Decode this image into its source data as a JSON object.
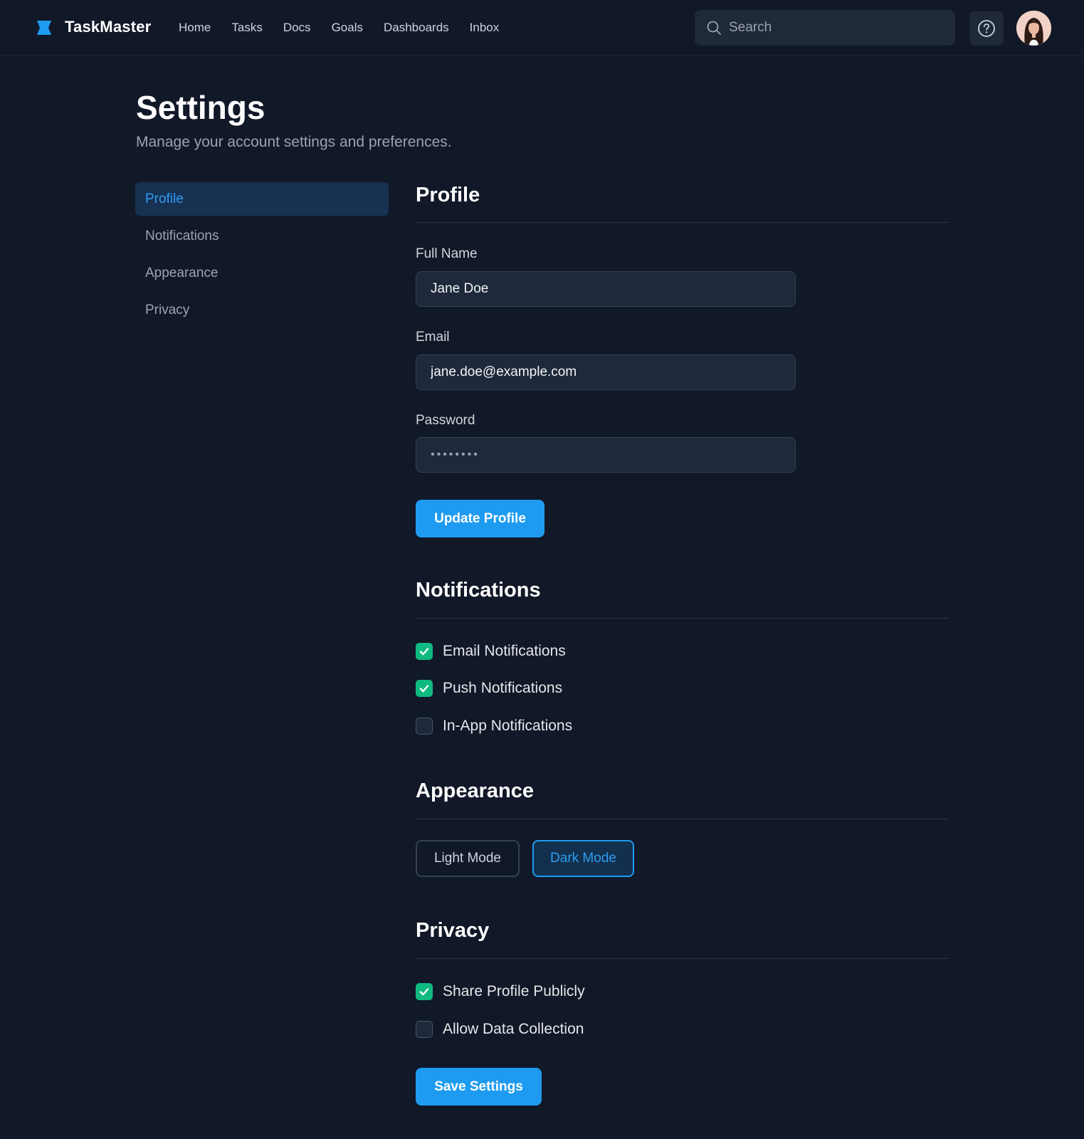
{
  "app": {
    "brand": "TaskMaster",
    "nav": [
      "Home",
      "Tasks",
      "Docs",
      "Goals",
      "Dashboards",
      "Inbox"
    ],
    "search_placeholder": "Search"
  },
  "page": {
    "title": "Settings",
    "subtitle": "Manage your account settings and preferences."
  },
  "sidebar": {
    "items": [
      {
        "label": "Profile",
        "active": true
      },
      {
        "label": "Notifications",
        "active": false
      },
      {
        "label": "Appearance",
        "active": false
      },
      {
        "label": "Privacy",
        "active": false
      }
    ]
  },
  "profile": {
    "title": "Profile",
    "full_name_label": "Full Name",
    "full_name_value": "Jane Doe",
    "email_label": "Email",
    "email_value": "jane.doe@example.com",
    "password_label": "Password",
    "password_value": "••••••••",
    "update_button": "Update Profile"
  },
  "notifications": {
    "title": "Notifications",
    "options": [
      {
        "label": "Email Notifications",
        "checked": true
      },
      {
        "label": "Push Notifications",
        "checked": true
      },
      {
        "label": "In-App Notifications",
        "checked": false
      }
    ]
  },
  "appearance": {
    "title": "Appearance",
    "light_label": "Light Mode",
    "dark_label": "Dark Mode",
    "selected": "dark"
  },
  "privacy": {
    "title": "Privacy",
    "options": [
      {
        "label": "Share Profile Publicly",
        "checked": true
      },
      {
        "label": "Allow Data Collection",
        "checked": false
      }
    ],
    "save_button": "Save Settings"
  },
  "colors": {
    "background": "#111827",
    "accent": "#1e9bf0",
    "check_on": "#10b981"
  }
}
